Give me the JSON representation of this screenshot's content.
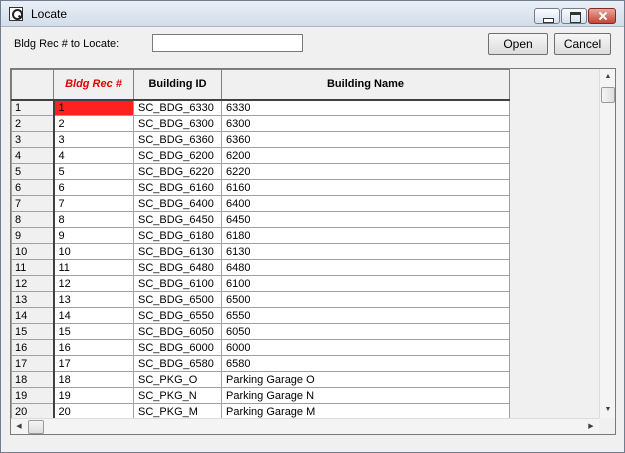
{
  "window": {
    "title": "Locate",
    "icon": "magnifier-app-icon"
  },
  "search": {
    "label": "Bldg Rec # to Locate:",
    "value": "",
    "placeholder": ""
  },
  "buttons": {
    "open": "Open",
    "cancel": "Cancel"
  },
  "grid": {
    "columns": [
      "",
      "Bldg Rec #",
      "Building ID",
      "Building Name"
    ],
    "sorted_column": "Bldg Rec #",
    "selected_row": 1,
    "colors": {
      "sorted_header": "#e00000",
      "selected_cell": "#ff2020"
    },
    "rows": [
      [
        "1",
        "1",
        "SC_BDG_6330",
        "6330"
      ],
      [
        "2",
        "2",
        "SC_BDG_6300",
        "6300"
      ],
      [
        "3",
        "3",
        "SC_BDG_6360",
        "6360"
      ],
      [
        "4",
        "4",
        "SC_BDG_6200",
        "6200"
      ],
      [
        "5",
        "5",
        "SC_BDG_6220",
        "6220"
      ],
      [
        "6",
        "6",
        "SC_BDG_6160",
        "6160"
      ],
      [
        "7",
        "7",
        "SC_BDG_6400",
        "6400"
      ],
      [
        "8",
        "8",
        "SC_BDG_6450",
        "6450"
      ],
      [
        "9",
        "9",
        "SC_BDG_6180",
        "6180"
      ],
      [
        "10",
        "10",
        "SC_BDG_6130",
        "6130"
      ],
      [
        "11",
        "11",
        "SC_BDG_6480",
        "6480"
      ],
      [
        "12",
        "12",
        "SC_BDG_6100",
        "6100"
      ],
      [
        "13",
        "13",
        "SC_BDG_6500",
        "6500"
      ],
      [
        "14",
        "14",
        "SC_BDG_6550",
        "6550"
      ],
      [
        "15",
        "15",
        "SC_BDG_6050",
        "6050"
      ],
      [
        "16",
        "16",
        "SC_BDG_6000",
        "6000"
      ],
      [
        "17",
        "17",
        "SC_BDG_6580",
        "6580"
      ],
      [
        "18",
        "18",
        "SC_PKG_O",
        "Parking Garage O"
      ],
      [
        "19",
        "19",
        "SC_PKG_N",
        "Parking Garage N"
      ],
      [
        "20",
        "20",
        "SC_PKG_M",
        "Parking Garage M"
      ]
    ]
  }
}
